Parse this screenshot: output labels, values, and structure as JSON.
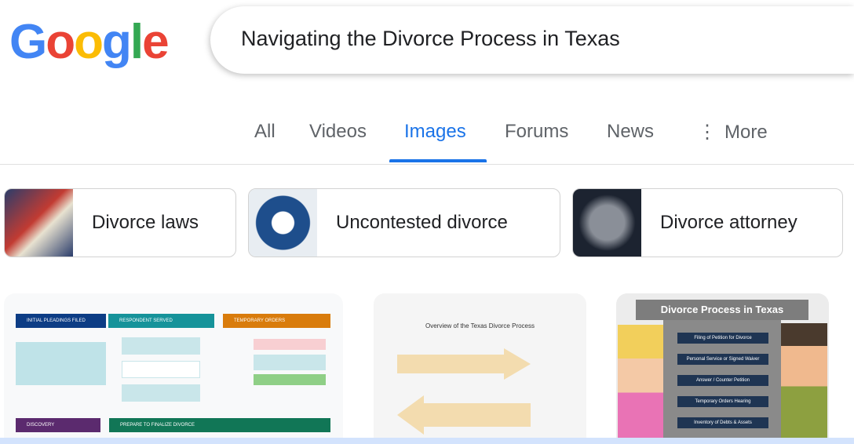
{
  "logo": {
    "text": "Google",
    "colors": [
      "#4285f4",
      "#ea4335",
      "#fbbc05",
      "#4285f4",
      "#34a853",
      "#ea4335"
    ]
  },
  "search": {
    "query": "Navigating the Divorce Process in Texas"
  },
  "tabs": [
    {
      "label": "All"
    },
    {
      "label": "Videos"
    },
    {
      "label": "Images",
      "active": true
    },
    {
      "label": "Forums"
    },
    {
      "label": "News"
    },
    {
      "label": "More"
    }
  ],
  "chips": [
    {
      "label": "Divorce laws"
    },
    {
      "label": "Uncontested divorce"
    },
    {
      "label": "Divorce attorney"
    }
  ],
  "results": [
    {
      "steps": [
        "INITIAL PLEADINGS FILED",
        "RESPONDENT SERVED",
        "TEMPORARY ORDERS",
        "DISCOVERY",
        "PREPARE TO FINALIZE DIVORCE"
      ]
    },
    {
      "title": "Overview of the Texas Divorce Process"
    },
    {
      "title": "Divorce Process in Texas",
      "steps": [
        "Filing of Petition for Divorce",
        "Personal Service or Signed Waiver",
        "Answer / Counter Petition",
        "Temporary Orders Hearing",
        "Inventory of Debts & Assets"
      ]
    }
  ],
  "accent": "#1a73e8"
}
